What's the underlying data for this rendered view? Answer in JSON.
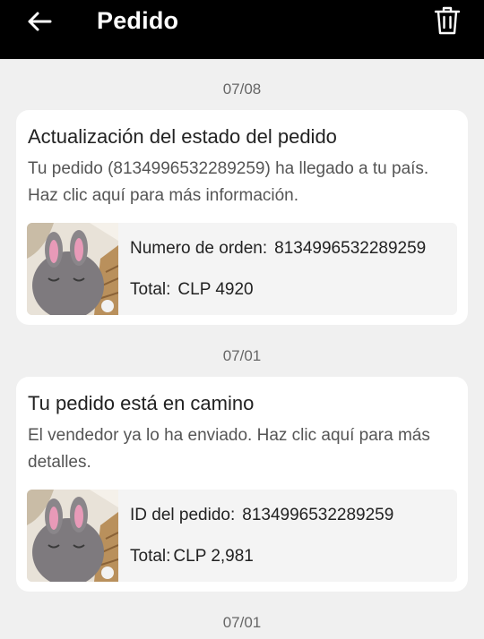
{
  "header": {
    "title": "Pedido"
  },
  "messages": [
    {
      "date": "07/08",
      "title": "Actualización del estado del pedido",
      "body": "Tu pedido (8134996532289259) ha llegado a tu país. Haz clic aquí para más información.",
      "order_label": "Numero de orden:",
      "order_value": "8134996532289259",
      "total_label": "Total:",
      "total_value": "CLP 4920"
    },
    {
      "date": "07/01",
      "title": "Tu pedido está en camino",
      "body": "El vendedor ya lo ha enviado. Haz clic aquí para más detalles.",
      "order_label": "ID del pedido:",
      "order_value": "8134996532289259",
      "total_label": "Total:",
      "total_value": "CLP 2,981"
    },
    {
      "date": "07/01"
    }
  ]
}
